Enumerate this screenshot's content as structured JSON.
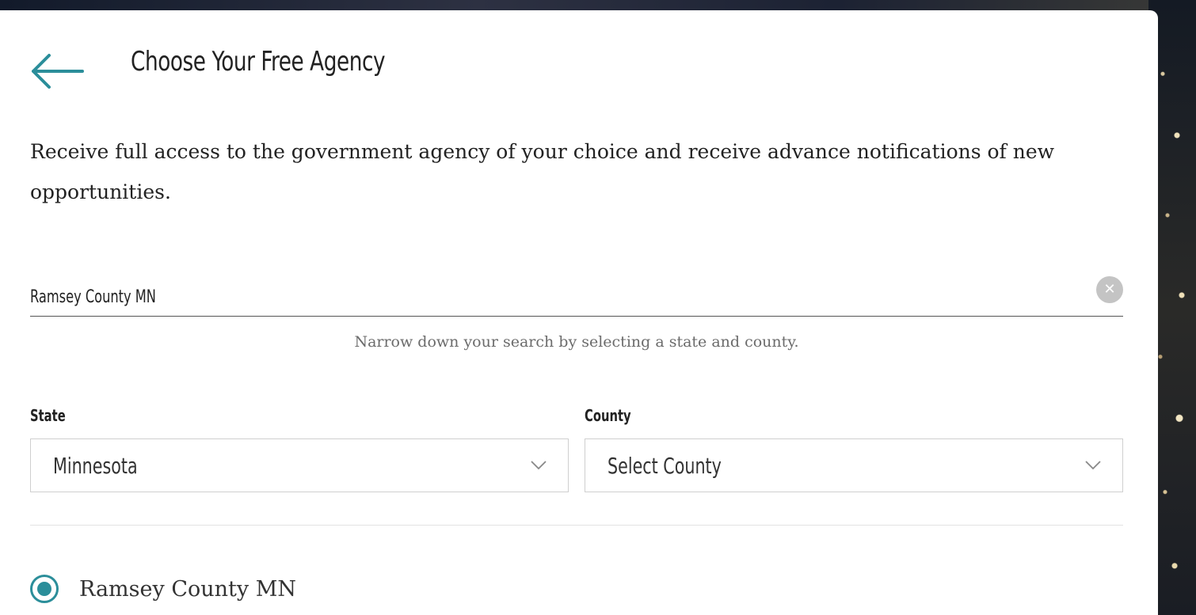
{
  "header": {
    "title": "Choose Your Free Agency",
    "back_icon": "arrow-left-icon"
  },
  "intro": {
    "text": "Receive full access to the government agency of your choice and receive advance notifications of new opportunities."
  },
  "search": {
    "value": "Ramsey County MN",
    "clear_icon": "clear-circle-icon",
    "clear_glyph": "✕"
  },
  "helper": {
    "text": "Narrow down your search by selecting a state and county."
  },
  "filters": {
    "state_label": "State",
    "state_value": "Minnesota",
    "county_label": "County",
    "county_value": "Select County"
  },
  "results": {
    "items": [
      {
        "label": "Ramsey County MN",
        "selected": true
      }
    ]
  },
  "colors": {
    "accent": "#2b8e9a",
    "text": "#222222",
    "muted": "#6b6b6b"
  }
}
